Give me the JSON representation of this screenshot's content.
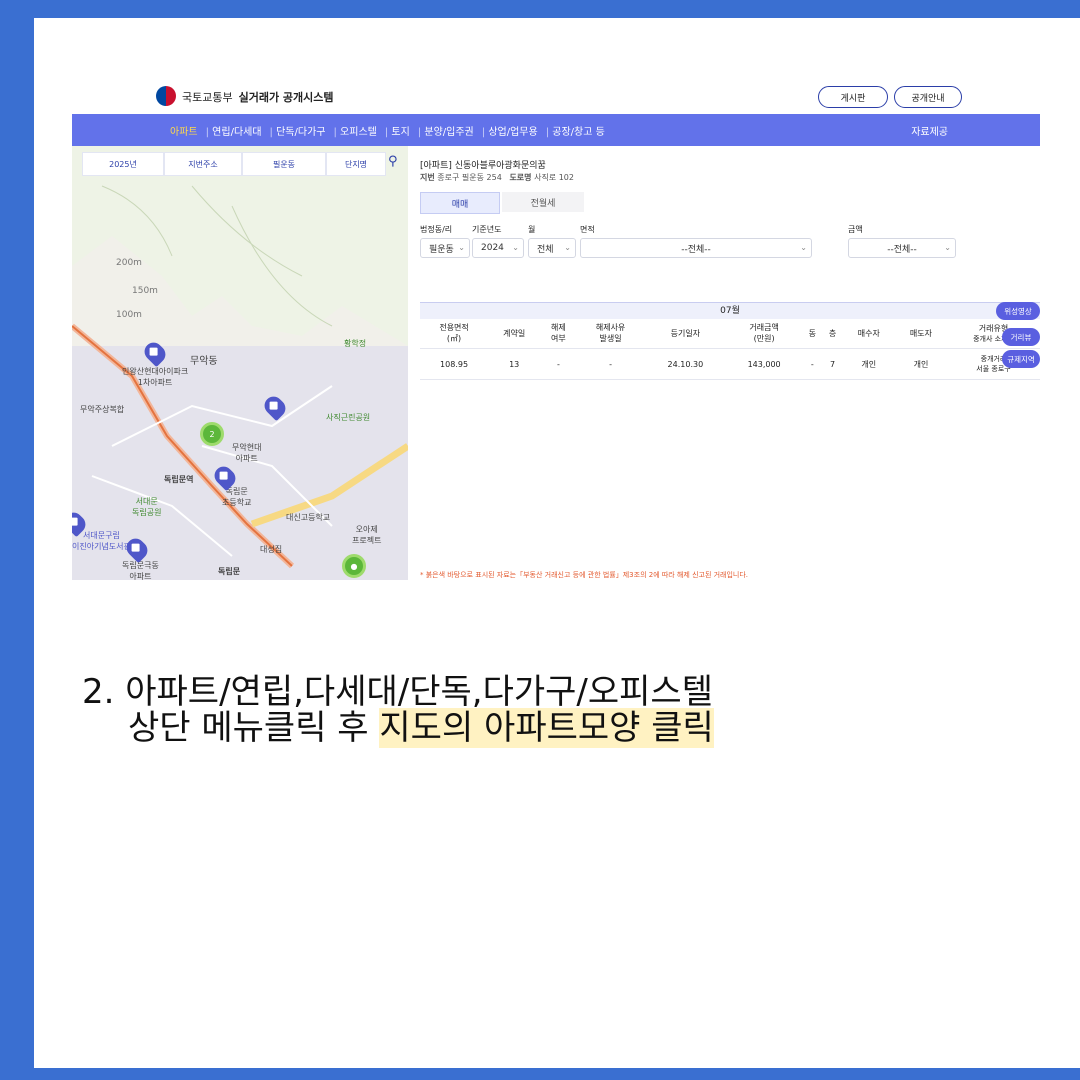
{
  "header": {
    "org": "국토교통부",
    "system": "실거래가 공개시스템",
    "board_btn": "게시판",
    "info_btn": "공개안내"
  },
  "nav": {
    "items": [
      "아파트",
      "연립/다세대",
      "단독/다가구",
      "오피스텔",
      "토지",
      "분양/입주권",
      "상업/업무용",
      "공장/창고 등"
    ],
    "active_index": 0,
    "right": "자료제공"
  },
  "map": {
    "filters": [
      "2025년",
      "지번주소",
      "필운동",
      "단지명"
    ],
    "labels": {
      "muak": "무악동",
      "inwang": "인왕산현대아이파크\n1차아파트",
      "muak_complex": "무악주상복합",
      "park": "사직근린공원",
      "hyundai": "무악현대\n아파트",
      "dokrip": "독립문역",
      "school": "독립문\n초등학교",
      "daesin": "대신고등학교",
      "seodaemun": "서대문\n독립공원",
      "daeseong": "대성집",
      "dokrip2": "독립문",
      "hwangsak": "황학정",
      "dist": "200m",
      "dist2": "150m",
      "dist3": "100m",
      "project": "오아제\n프로젝트",
      "park2": "서대문구립\n이진아기념도서관",
      "apt3": "독립문극동\n아파트"
    }
  },
  "detail": {
    "title": "[아파트] 신동아블루아광화문의꿈",
    "address_label1": "지번",
    "address1": "종로구 필운동 254",
    "address_label2": "도로명",
    "address2": "사직로 102",
    "tab_sale": "매매",
    "tab_rent": "전월세",
    "filter_labels": [
      "법정동/리",
      "기준년도",
      "월",
      "면적",
      "금액"
    ],
    "filter_values": [
      "필운동",
      "2024",
      "전체",
      "--전체--",
      "--전체--"
    ],
    "month": "07월",
    "columns": [
      "전용면적\n(㎡)",
      "계약일",
      "해제\n여부",
      "해제사유\n발생일",
      "등기일자",
      "거래금액\n(만원)",
      "동",
      "층",
      "매수자",
      "매도자",
      "거래유형"
    ],
    "row": [
      "108.95",
      "13",
      "-",
      "-",
      "24.10.30",
      "143,000",
      "-",
      "7",
      "개인",
      "개인",
      "중개거래"
    ],
    "extra1": "중개사 소재지",
    "extra2": "서울 종로구",
    "bubbles": [
      "위성영상",
      "거리뷰",
      "규제지역"
    ],
    "footnote": "* 붉은색 바탕으로 표시된 자료는「부동산 거래신고 등에 관한 법률」제3조의 2에 따라 해제 신고된 거래입니다."
  },
  "caption": {
    "line1": "2. 아파트/연립,다세대/단독,다가구/오피스텔",
    "line2_plain": "상단 메뉴클릭 후 ",
    "line2_highlight": "지도의 아파트모양 클릭"
  }
}
